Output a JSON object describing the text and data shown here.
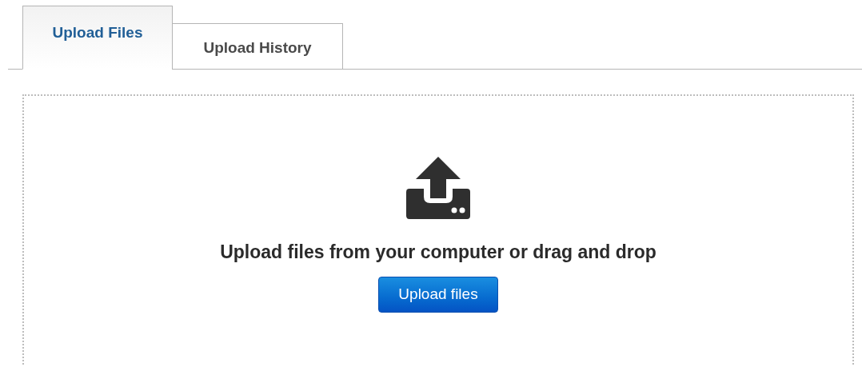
{
  "tabs": [
    {
      "label": "Upload Files",
      "selected": true
    },
    {
      "label": "Upload History",
      "selected": false
    }
  ],
  "dropzone": {
    "message": "Upload files from your computer or drag and drop",
    "button": "Upload files"
  }
}
